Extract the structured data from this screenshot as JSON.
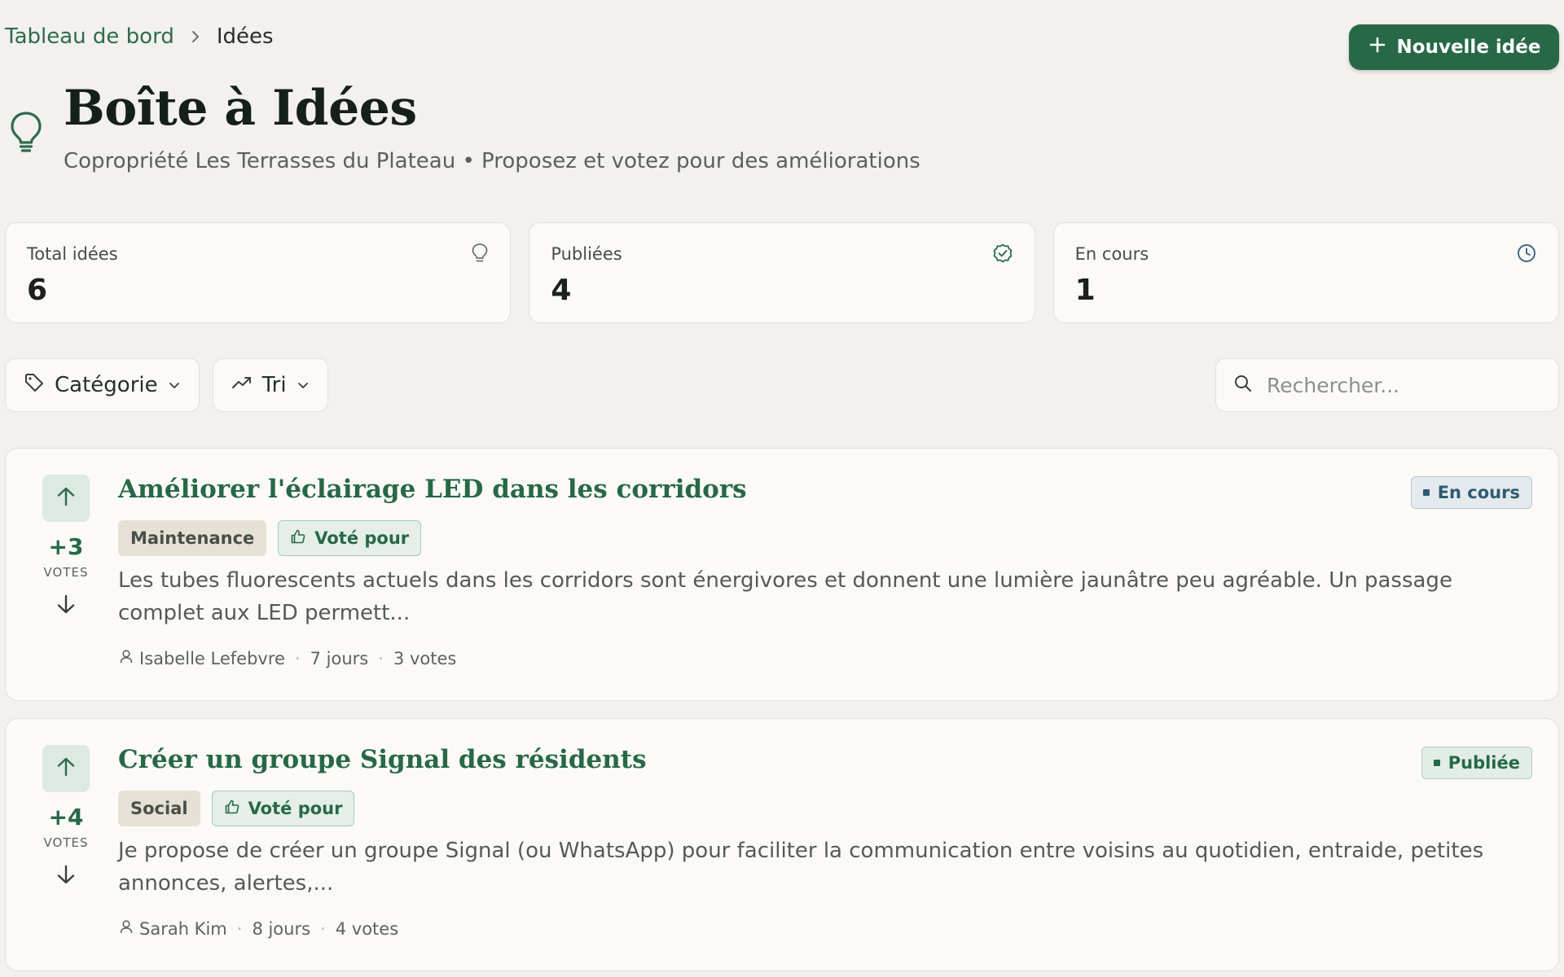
{
  "breadcrumb": {
    "parent": "Tableau de bord",
    "current": "Idées"
  },
  "header": {
    "new_button": "Nouvelle idée",
    "title": "Boîte à Idées",
    "subtitle": "Copropriété Les Terrasses du Plateau • Proposez et votez pour des améliorations"
  },
  "stats": [
    {
      "label": "Total idées",
      "value": "6",
      "icon": "lightbulb-icon"
    },
    {
      "label": "Publiées",
      "value": "4",
      "icon": "check-circle-icon"
    },
    {
      "label": "En cours",
      "value": "1",
      "icon": "clock-icon"
    }
  ],
  "filters": {
    "category": "Catégorie",
    "sort": "Tri",
    "search_placeholder": "Rechercher..."
  },
  "ideas": [
    {
      "title": "Améliorer l'éclairage LED dans les corridors",
      "status": "En cours",
      "category": "Maintenance",
      "voted": "Voté pour",
      "score": "+3",
      "votes_label": "VOTES",
      "description": "Les tubes fluorescents actuels dans les corridors sont énergivores et donnent une lumière jaunâtre peu agréable. Un passage complet aux LED permett...",
      "author": "Isabelle Lefebvre",
      "age": "7 jours",
      "vote_count": "3 votes"
    },
    {
      "title": "Créer un groupe Signal des résidents",
      "status": "Publiée",
      "category": "Social",
      "voted": "Voté pour",
      "score": "+4",
      "votes_label": "VOTES",
      "description": "Je propose de créer un groupe Signal (ou WhatsApp) pour faciliter la communication entre voisins au quotidien, entraide, petites annonces, alertes,...",
      "author": "Sarah Kim",
      "age": "8 jours",
      "vote_count": "4 votes"
    }
  ],
  "colors": {
    "primary": "#276847",
    "background": "#f3f1ed",
    "card": "#fbfaf7"
  }
}
